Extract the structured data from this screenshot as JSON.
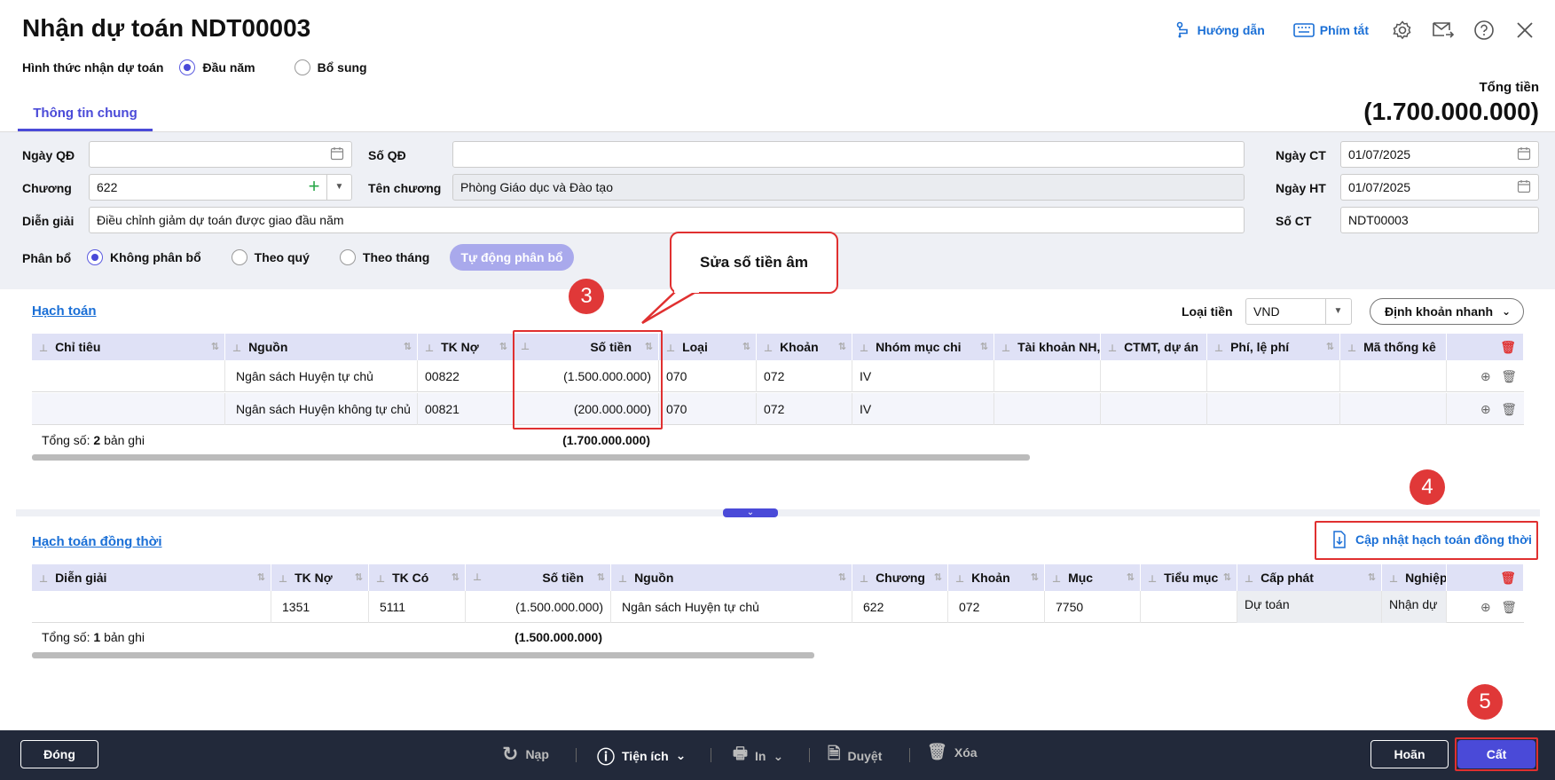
{
  "header": {
    "title": "Nhận dự toán NDT00003",
    "links": {
      "guide": "Hướng dẫn",
      "shortcuts": "Phím tắt"
    },
    "receive_type_label": "Hình thức nhận dự toán",
    "receive_type_options": [
      "Đầu năm",
      "Bổ sung"
    ],
    "receive_type_selected": "Đầu năm",
    "total_label": "Tổng tiền",
    "total_value": "(1.700.000.000)"
  },
  "tabs": [
    "Thông tin chung"
  ],
  "form": {
    "ngay_qd_label": "Ngày QĐ",
    "ngay_qd_value": "",
    "so_qd_label": "Số QĐ",
    "so_qd_value": "",
    "chuong_label": "Chương",
    "chuong_value": "622",
    "ten_chuong_label": "Tên chương",
    "ten_chuong_value": "Phòng Giáo dục và Đào tạo",
    "dien_giai_label": "Diễn giải",
    "dien_giai_value": "Điều chỉnh giảm dự toán được giao đầu năm",
    "ngay_ct_label": "Ngày CT",
    "ngay_ct_value": "01/07/2025",
    "ngay_ht_label": "Ngày HT",
    "ngay_ht_value": "01/07/2025",
    "so_ct_label": "Số CT",
    "so_ct_value": "NDT00003",
    "phan_bo_label": "Phân bổ",
    "phan_bo_options": [
      "Không phân bổ",
      "Theo quý",
      "Theo tháng"
    ],
    "phan_bo_selected": "Không phân bổ",
    "auto_allocate": "Tự động phân bổ"
  },
  "hach_toan": {
    "title": "Hạch toán",
    "currency_label": "Loại tiền",
    "currency_value": "VND",
    "quick_entry": "Định khoản nhanh",
    "columns": [
      "Chỉ tiêu",
      "Nguồn",
      "TK Nợ",
      "Số tiền",
      "Loại",
      "Khoản",
      "Nhóm mục chi",
      "Tài khoản NH,",
      "CTMT, dự án",
      "Phí, lệ phí",
      "Mã thống kê"
    ],
    "rows": [
      {
        "chi_tieu": "",
        "nguon": "Ngân sách Huyện tự chủ",
        "tk_no": "00822",
        "so_tien": "(1.500.000.000)",
        "loai": "070",
        "khoan": "072",
        "nhom": "IV"
      },
      {
        "chi_tieu": "",
        "nguon": "Ngân sách Huyện không tự chủ",
        "tk_no": "00821",
        "so_tien": "(200.000.000)",
        "loai": "070",
        "khoan": "072",
        "nhom": "IV"
      }
    ],
    "total_prefix": "Tổng số:",
    "total_count": "2",
    "total_suffix": "bản ghi",
    "total_amount": "(1.700.000.000)"
  },
  "hach_toan_dong_thoi": {
    "title": "Hạch toán đồng thời",
    "update_button": "Cập nhật hạch toán đồng thời",
    "columns": [
      "Diễn giải",
      "TK Nợ",
      "TK Có",
      "Số tiền",
      "Nguồn",
      "Chương",
      "Khoản",
      "Mục",
      "Tiểu mục",
      "Cấp phát",
      "Nghiệp"
    ],
    "rows": [
      {
        "dien_giai": "",
        "tk_no": "1351",
        "tk_co": "5111",
        "so_tien": "(1.500.000.000)",
        "nguon": "Ngân sách Huyện tự chủ",
        "chuong": "622",
        "khoan": "072",
        "muc": "7750",
        "tieu_muc": "",
        "cap_phat": "Dự toán",
        "nghiep": "Nhận dự"
      }
    ],
    "total_prefix": "Tổng số:",
    "total_count": "1",
    "total_suffix": "bản ghi",
    "total_amount": "(1.500.000.000)"
  },
  "annotations": {
    "callout": "Sửa số tiền âm",
    "step3": "3",
    "step4": "4",
    "step5": "5"
  },
  "footer": {
    "close": "Đóng",
    "reload": "Nạp",
    "utilities": "Tiện ích",
    "print": "In",
    "approve": "Duyệt",
    "delete": "Xóa",
    "cancel": "Hoãn",
    "save": "Cất"
  },
  "colors": {
    "accent": "#4a4ad8",
    "link": "#1a6fd6",
    "annotation": "#e03030",
    "footer_bg": "#22293a"
  }
}
